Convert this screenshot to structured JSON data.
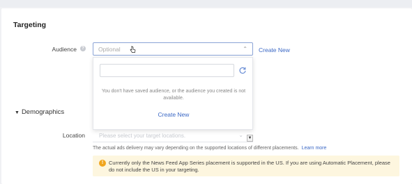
{
  "section": {
    "title": "Targeting"
  },
  "audience": {
    "label": "Audience",
    "placeholder": "Optional",
    "create_new_link": "Create New",
    "dropdown": {
      "search_value": "",
      "empty_message": "You don't have saved audience, or the audience you created is not available.",
      "create_new": "Create New"
    }
  },
  "demographics": {
    "title": "Demographics"
  },
  "location": {
    "label": "Location",
    "placeholder": "Please select your target locations."
  },
  "notice": {
    "text": "The actual ads delivery may vary depending on the supported locations of different placements.",
    "learn_more": "Learn more"
  },
  "alert": {
    "message": "Currently only the News Feed App Series placement is supported in the US. If you are using Automatic Placement, please do not include the US in your targeting."
  },
  "colors": {
    "link": "#3b68c5",
    "warning": "#f0a51f",
    "alert_bg": "#fdf6df",
    "focus_border": "#8aa3d6"
  },
  "icons": [
    "help-icon",
    "chevron-up-icon",
    "refresh-icon",
    "triangle-down-icon",
    "chevron-down-icon",
    "warning-icon",
    "pointer-cursor-icon"
  ]
}
